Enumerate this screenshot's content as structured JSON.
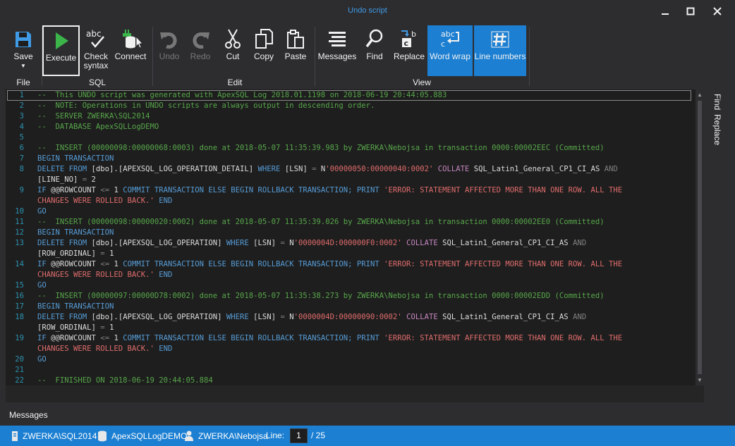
{
  "window": {
    "title": "Undo script"
  },
  "ribbon": {
    "buttons": {
      "save": "Save",
      "execute": "Execute",
      "check_syntax_1": "Check",
      "check_syntax_2": "syntax",
      "connect": "Connect",
      "undo": "Undo",
      "redo": "Redo",
      "cut": "Cut",
      "copy": "Copy",
      "paste": "Paste",
      "messages": "Messages",
      "find": "Find",
      "replace": "Replace",
      "word_wrap": "Word wrap",
      "line_numbers": "Line numbers"
    },
    "groups": {
      "file": "File",
      "sql": "SQL",
      "edit": "Edit",
      "view": "View"
    }
  },
  "editor": {
    "lines": [
      {
        "n": "1",
        "parts": [
          [
            "c",
            "--  This UNDO script was generated with ApexSQL Log 2018.01.1198 on 2018-06-19 20:44:05.883"
          ]
        ]
      },
      {
        "n": "2",
        "parts": [
          [
            "c",
            "--  NOTE: Operations in UNDO scripts are always output in descending order."
          ]
        ]
      },
      {
        "n": "3",
        "parts": [
          [
            "c",
            "--  SERVER ZWERKA\\SQL2014"
          ]
        ]
      },
      {
        "n": "4",
        "parts": [
          [
            "c",
            "--  DATABASE ApexSQLLogDEMO"
          ]
        ]
      },
      {
        "n": "5",
        "parts": []
      },
      {
        "n": "6",
        "parts": [
          [
            "c",
            "--  INSERT (00000098:00000068:0003) done at 2018-05-07 11:35:39.983 by ZWERKA\\Nebojsa in transaction 0000:00002EEC (Committed)"
          ]
        ]
      },
      {
        "n": "7",
        "parts": [
          [
            "k",
            "BEGIN TRANSACTION"
          ]
        ]
      },
      {
        "n": "8",
        "parts": [
          [
            "k",
            "DELETE FROM "
          ],
          [
            "t",
            "[dbo].[APEXSQL_LOG_OPERATION_DETAIL] "
          ],
          [
            "k",
            "WHERE "
          ],
          [
            "t",
            "[LSN] "
          ],
          [
            "g",
            "= "
          ],
          [
            "t",
            "N"
          ],
          [
            "s2",
            "'00000050:00000040:0002' "
          ],
          [
            "m",
            "COLLATE "
          ],
          [
            "t",
            "SQL_Latin1_General_CP1_CI_AS "
          ],
          [
            "g",
            "AND"
          ]
        ]
      },
      {
        "n": "",
        "parts": [
          [
            "t",
            "[LINE_NO] "
          ],
          [
            "g",
            "= "
          ],
          [
            "t",
            "2"
          ]
        ]
      },
      {
        "n": "9",
        "parts": [
          [
            "k",
            "IF "
          ],
          [
            "t",
            "@@ROWCOUNT "
          ],
          [
            "g",
            "<= "
          ],
          [
            "t",
            "1 "
          ],
          [
            "k",
            "COMMIT TRANSACTION ELSE BEGIN ROLLBACK TRANSACTION; PRINT "
          ],
          [
            "s2",
            "'ERROR: STATEMENT AFFECTED MORE THAN ONE ROW. ALL THE"
          ]
        ]
      },
      {
        "n": "",
        "parts": [
          [
            "s2",
            "CHANGES WERE ROLLED BACK.' "
          ],
          [
            "k",
            "END"
          ]
        ]
      },
      {
        "n": "10",
        "parts": [
          [
            "k",
            "GO"
          ]
        ]
      },
      {
        "n": "11",
        "parts": [
          [
            "c",
            "--  INSERT (00000098:00000020:0002) done at 2018-05-07 11:35:39.026 by ZWERKA\\Nebojsa in transaction 0000:00002EE0 (Committed)"
          ]
        ]
      },
      {
        "n": "12",
        "parts": [
          [
            "k",
            "BEGIN TRANSACTION"
          ]
        ]
      },
      {
        "n": "13",
        "parts": [
          [
            "k",
            "DELETE FROM "
          ],
          [
            "t",
            "[dbo].[APEXSQL_LOG_OPERATION] "
          ],
          [
            "k",
            "WHERE "
          ],
          [
            "t",
            "[LSN] "
          ],
          [
            "g",
            "= "
          ],
          [
            "t",
            "N"
          ],
          [
            "s2",
            "'0000004D:000000F0:0002' "
          ],
          [
            "m",
            "COLLATE "
          ],
          [
            "t",
            "SQL_Latin1_General_CP1_CI_AS "
          ],
          [
            "g",
            "AND"
          ]
        ]
      },
      {
        "n": "",
        "parts": [
          [
            "t",
            "[ROW_ORDINAL] "
          ],
          [
            "g",
            "= "
          ],
          [
            "t",
            "1"
          ]
        ]
      },
      {
        "n": "14",
        "parts": [
          [
            "k",
            "IF "
          ],
          [
            "t",
            "@@ROWCOUNT "
          ],
          [
            "g",
            "<= "
          ],
          [
            "t",
            "1 "
          ],
          [
            "k",
            "COMMIT TRANSACTION ELSE BEGIN ROLLBACK TRANSACTION; PRINT "
          ],
          [
            "s2",
            "'ERROR: STATEMENT AFFECTED MORE THAN ONE ROW. ALL THE"
          ]
        ]
      },
      {
        "n": "",
        "parts": [
          [
            "s2",
            "CHANGES WERE ROLLED BACK.' "
          ],
          [
            "k",
            "END"
          ]
        ]
      },
      {
        "n": "15",
        "parts": [
          [
            "k",
            "GO"
          ]
        ]
      },
      {
        "n": "16",
        "parts": [
          [
            "c",
            "--  INSERT (00000097:00000D78:0002) done at 2018-05-07 11:35:38.273 by ZWERKA\\Nebojsa in transaction 0000:00002EDD (Committed)"
          ]
        ]
      },
      {
        "n": "17",
        "parts": [
          [
            "k",
            "BEGIN TRANSACTION"
          ]
        ]
      },
      {
        "n": "18",
        "parts": [
          [
            "k",
            "DELETE FROM "
          ],
          [
            "t",
            "[dbo].[APEXSQL_LOG_OPERATION] "
          ],
          [
            "k",
            "WHERE "
          ],
          [
            "t",
            "[LSN] "
          ],
          [
            "g",
            "= "
          ],
          [
            "t",
            "N"
          ],
          [
            "s2",
            "'0000004D:00000090:0002' "
          ],
          [
            "m",
            "COLLATE "
          ],
          [
            "t",
            "SQL_Latin1_General_CP1_CI_AS "
          ],
          [
            "g",
            "AND"
          ]
        ]
      },
      {
        "n": "",
        "parts": [
          [
            "t",
            "[ROW_ORDINAL] "
          ],
          [
            "g",
            "= "
          ],
          [
            "t",
            "1"
          ]
        ]
      },
      {
        "n": "19",
        "parts": [
          [
            "k",
            "IF "
          ],
          [
            "t",
            "@@ROWCOUNT "
          ],
          [
            "g",
            "<= "
          ],
          [
            "t",
            "1 "
          ],
          [
            "k",
            "COMMIT TRANSACTION ELSE BEGIN ROLLBACK TRANSACTION; PRINT "
          ],
          [
            "s2",
            "'ERROR: STATEMENT AFFECTED MORE THAN ONE ROW. ALL THE"
          ]
        ]
      },
      {
        "n": "",
        "parts": [
          [
            "s2",
            "CHANGES WERE ROLLED BACK.' "
          ],
          [
            "k",
            "END"
          ]
        ]
      },
      {
        "n": "20",
        "parts": [
          [
            "k",
            "GO"
          ]
        ]
      },
      {
        "n": "21",
        "parts": []
      },
      {
        "n": "22",
        "parts": [
          [
            "c",
            "--  FINISHED ON 2018-06-19 20:44:05.884"
          ]
        ]
      }
    ]
  },
  "side_tabs": {
    "find": "Find",
    "replace": "Replace"
  },
  "messages_tab": "Messages",
  "status": {
    "server": "ZWERKA\\SQL2014",
    "database": "ApexSQLLogDEMO",
    "user": "ZWERKA\\Nebojsa",
    "line_label": "Line:",
    "line_value": "1",
    "line_total": "/ 25"
  },
  "colors": {
    "accent": "#1c7fd2",
    "title": "#3f9be6",
    "comment": "#57a64a",
    "keyword": "#569cd6",
    "string": "#e06c6c"
  }
}
